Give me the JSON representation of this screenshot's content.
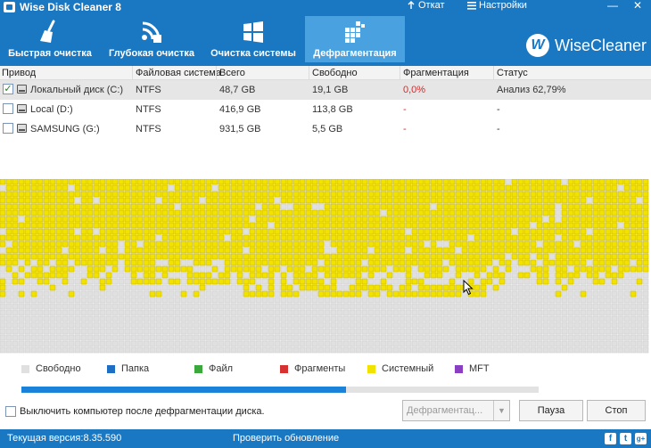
{
  "window": {
    "title": "Wise Disk Cleaner 8",
    "rollback_label": "Откат",
    "settings_label": "Настройки",
    "minimize": "—",
    "close": "✕"
  },
  "tabs": [
    {
      "label": "Быстрая очистка",
      "icon": "broom-icon"
    },
    {
      "label": "Глубокая очистка",
      "icon": "deep-clean-icon"
    },
    {
      "label": "Очистка системы",
      "icon": "windows-icon"
    },
    {
      "label": "Дефрагментация",
      "icon": "defrag-icon",
      "active": true
    }
  ],
  "brand": {
    "letter": "W",
    "name": "WiseCleaner"
  },
  "table": {
    "headers": [
      "Привод",
      "Файловая система",
      "Всего",
      "Свободно",
      "Фрагментация",
      "Статус"
    ],
    "rows": [
      {
        "drive": "Локальный диск (C:)",
        "fs": "NTFS",
        "total": "48,7 GB",
        "free": "19,1 GB",
        "frag": "0,0%",
        "status": "Анализ 62,79%",
        "checked": true,
        "selected": true
      },
      {
        "drive": "Local (D:)",
        "fs": "NTFS",
        "total": "416,9 GB",
        "free": "113,8 GB",
        "frag": "-",
        "status": "-",
        "checked": false,
        "selected": false
      },
      {
        "drive": "SAMSUNG (G:)",
        "fs": "NTFS",
        "total": "931,5 GB",
        "free": "5,5 GB",
        "frag": "-",
        "status": "-",
        "checked": false,
        "selected": false
      }
    ]
  },
  "legend": [
    {
      "label": "Свободно",
      "color": "#e0e0e0"
    },
    {
      "label": "Папка",
      "color": "#1e6fc4"
    },
    {
      "label": "Файл",
      "color": "#3aa83a"
    },
    {
      "label": "Фрагменты",
      "color": "#d63030"
    },
    {
      "label": "Системный",
      "color": "#f2e200"
    },
    {
      "label": "MFT",
      "color": "#8a3ec2"
    }
  ],
  "progress": {
    "value": 62.79
  },
  "options": {
    "shutdown_label": "Выключить компьютер после дефрагментации диска."
  },
  "buttons": {
    "defrag": "Дефрагментац...",
    "pause": "Пауза",
    "stop": "Стоп"
  },
  "status": {
    "version": "Текущая версия:8.35.590",
    "check_update": "Проверить обновление",
    "social": [
      "f",
      "t",
      "g+"
    ]
  },
  "colors": {
    "accent": "#1a78c2",
    "active_tab": "#4aa1e0",
    "system_block": "#f2e200",
    "free_block": "#e0e0e0"
  }
}
